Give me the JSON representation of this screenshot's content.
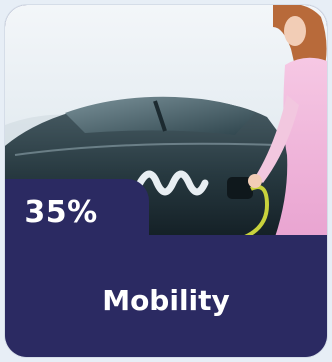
{
  "card": {
    "percentage": "35%",
    "title": "Mobility",
    "image": "electric-car-charging-photo",
    "colors": {
      "panel": "#2b2a62",
      "text": "#ffffff"
    }
  }
}
